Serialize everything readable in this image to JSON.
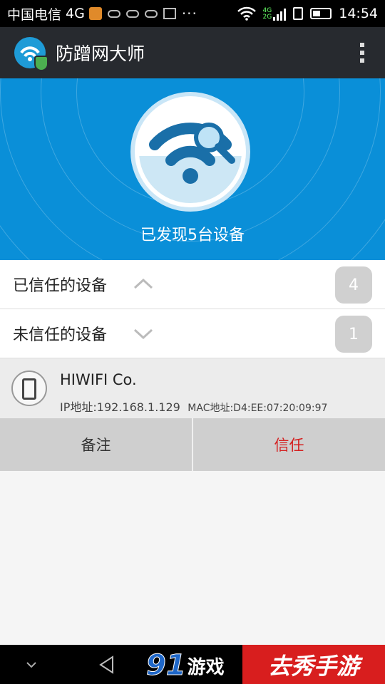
{
  "status_bar": {
    "carrier": "中国电信",
    "network": "4G",
    "time": "14:54",
    "icons": [
      "notification-icon",
      "cloud-icon",
      "cloud-icon",
      "cloud-icon",
      "image-icon",
      "more-dots-icon",
      "wifi-icon",
      "signal-4g-2g-icon",
      "sim-icon",
      "battery-icon"
    ]
  },
  "app_bar": {
    "title": "防蹭网大师",
    "logo_icon": "wifi-shield-logo-icon",
    "menu_icon": "overflow-menu-icon"
  },
  "hero": {
    "found_text": "已发现5台设备",
    "icon": "wifi-search-icon",
    "color": "#0a8fd8"
  },
  "trusted": {
    "label": "已信任的设备",
    "count": "4",
    "expanded": true
  },
  "untrusted": {
    "label": "未信任的设备",
    "count": "1",
    "expanded": false
  },
  "device": {
    "name": "HIWIFI Co.",
    "ip": "IP地址:192.168.1.129",
    "mac": "MAC地址:D4:EE:07:20:09:97",
    "icon": "phone-icon"
  },
  "actions": {
    "note": "备注",
    "trust": "信任",
    "trust_color": "#d42020"
  },
  "nav_bar": {
    "watermark_left_num": "91",
    "watermark_left_text": "游戏",
    "watermark_right": "去秀手游"
  }
}
